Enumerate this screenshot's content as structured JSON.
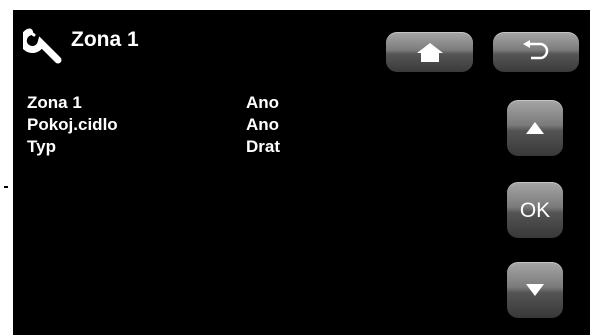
{
  "header": {
    "title": "Zona 1",
    "icon": "wrench-icon",
    "home_icon": "home-icon",
    "back_icon": "back-arrow-icon"
  },
  "settings": [
    {
      "label": "Zona 1",
      "value": "Ano"
    },
    {
      "label": "Pokoj.cidlo",
      "value": "Ano"
    },
    {
      "label": "Typ",
      "value": "Drat"
    }
  ],
  "navigation": {
    "up_icon": "up-arrow-icon",
    "ok_label": "OK",
    "down_icon": "down-arrow-icon"
  },
  "colors": {
    "background": "#000000",
    "text": "#ffffff",
    "button_gradient_top": "#a7a7a7",
    "button_gradient_bottom": "#3a3a3a"
  }
}
